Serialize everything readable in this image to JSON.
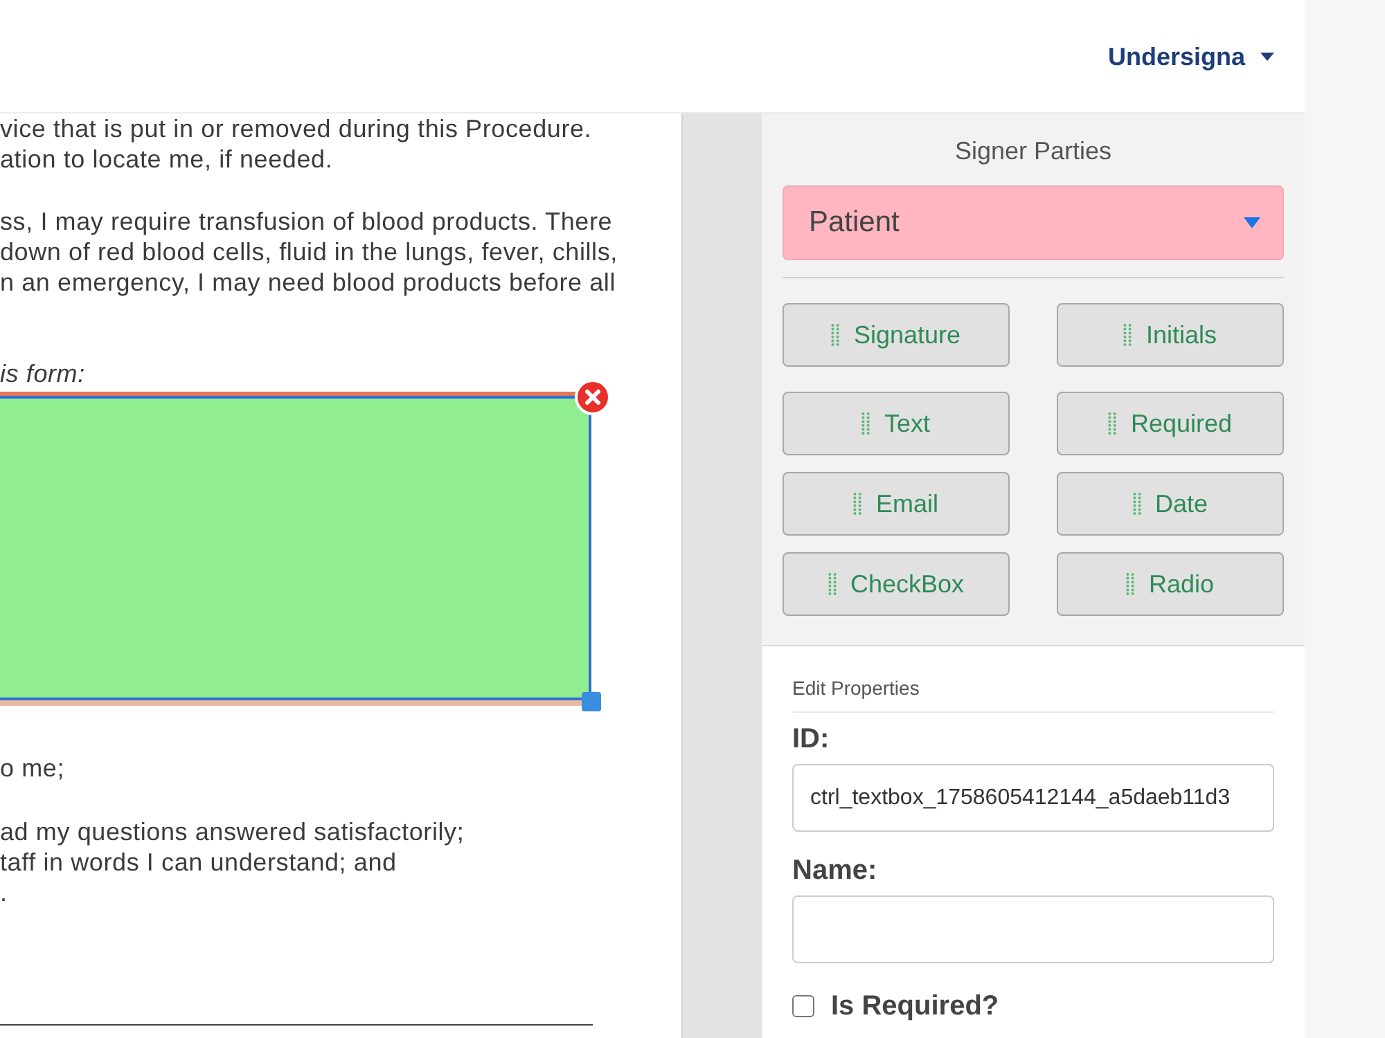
{
  "navbar": {
    "user_menu": "Undersigna"
  },
  "document": {
    "blocks": [
      {
        "kind": "paragraph",
        "lines": [
          "vice that is put in or removed during this Procedure.",
          "ation to locate me, if needed."
        ]
      },
      {
        "kind": "paragraph",
        "lines": [
          "ss, I may require transfusion of blood products. There",
          "down of red blood cells, fluid in the lungs, fever, chills,",
          "n an emergency, I may need blood products before all"
        ]
      },
      {
        "kind": "caption",
        "lines": [
          "is form:"
        ]
      },
      {
        "kind": "field",
        "selected": true
      },
      {
        "kind": "paragraph",
        "lines": [
          "o me;"
        ]
      },
      {
        "kind": "paragraph",
        "lines": [
          "ad my questions answered satisfactorily;",
          "taff in words I can understand; and",
          "."
        ]
      },
      {
        "kind": "signature_line"
      }
    ]
  },
  "signer_parties": {
    "title": "Signer Parties",
    "selected_party": "Patient"
  },
  "field_buttons": [
    {
      "label": "Signature"
    },
    {
      "label": "Initials"
    },
    {
      "label": "Text"
    },
    {
      "label": "Required"
    },
    {
      "label": "Email"
    },
    {
      "label": "Date"
    },
    {
      "label": "CheckBox"
    },
    {
      "label": "Radio"
    }
  ],
  "edit_properties": {
    "title": "Edit Properties",
    "fields": [
      {
        "label": "ID:",
        "value": "ctrl_textbox_1758605412144_a5daeb11d3"
      },
      {
        "label": "Name:"
      }
    ],
    "is_required": {
      "label": "Is Required?",
      "checked": false
    }
  }
}
